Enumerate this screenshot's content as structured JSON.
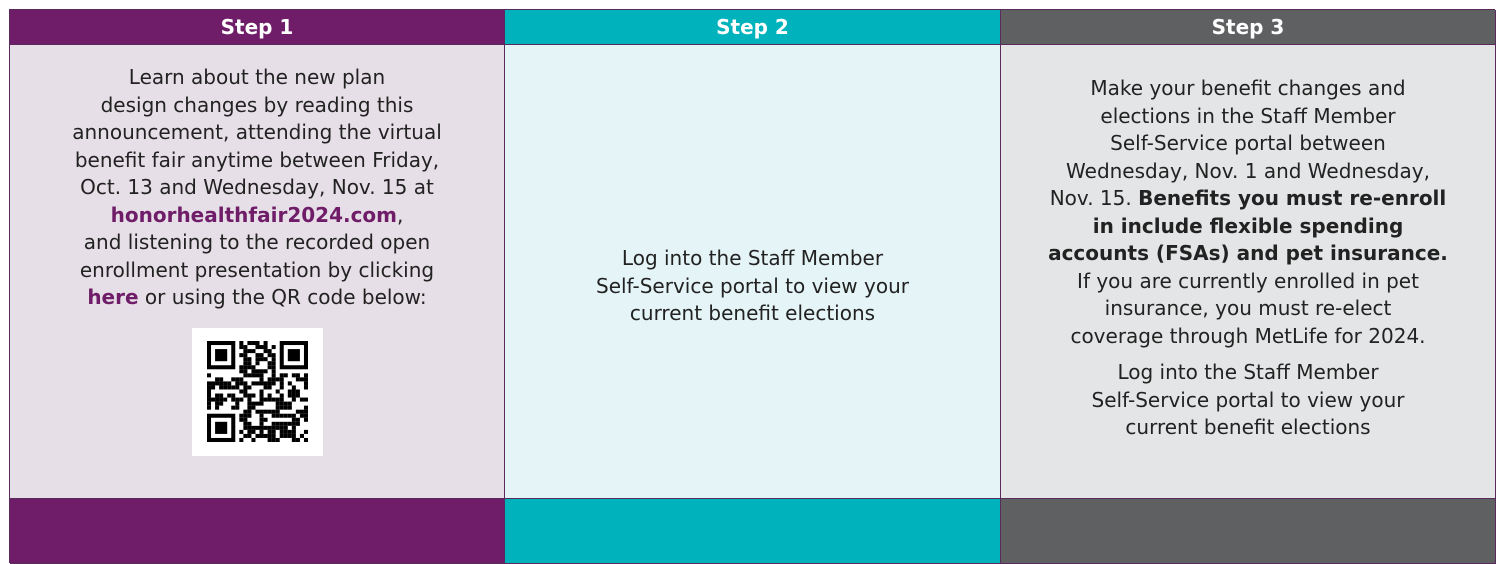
{
  "headers": [
    "Step 1",
    "Step 2",
    "Step 3"
  ],
  "step1": {
    "lines": [
      "Learn about the new plan",
      "design changes by reading this",
      "announcement, attending the virtual",
      "benefit fair anytime between Friday,",
      "Oct. 13 and Wednesday, Nov. 15 at"
    ],
    "fair_link": "honorhealthfair2024.com",
    "fair_link_after": ",",
    "line_after1": "and listening to the recorded open",
    "line_after2": "enrollment presentation by clicking",
    "here_link": "here",
    "here_after": " or using the QR code below:"
  },
  "step2": {
    "lines": [
      "Log into the Staff Member",
      "Self-Service portal to view your",
      "current benefit elections"
    ]
  },
  "step3": {
    "p1_lines": [
      "Make your benefit changes and",
      "elections in the Staff Member",
      "Self-Service portal between",
      "Wednesday, Nov. 1 and Wednesday,"
    ],
    "p1_mixed_before": "Nov. 15. ",
    "p1_bold_1": "Benefits you must re-enroll",
    "p1_bold_2": "in include flexible spending",
    "p1_bold_3": "accounts (FSAs) and pet insurance.",
    "p1_after_lines": [
      "If you are currently enrolled in pet",
      "insurance, you must re-elect",
      "coverage through MetLife for 2024."
    ],
    "p2_lines": [
      "Log into the Staff Member",
      "Self-Service portal to view your",
      "current benefit elections"
    ]
  },
  "icons": {
    "qr": "qr-code-icon"
  },
  "colors": {
    "purple": "#6f1d68",
    "teal": "#00b2bb",
    "gray": "#5f6062"
  }
}
